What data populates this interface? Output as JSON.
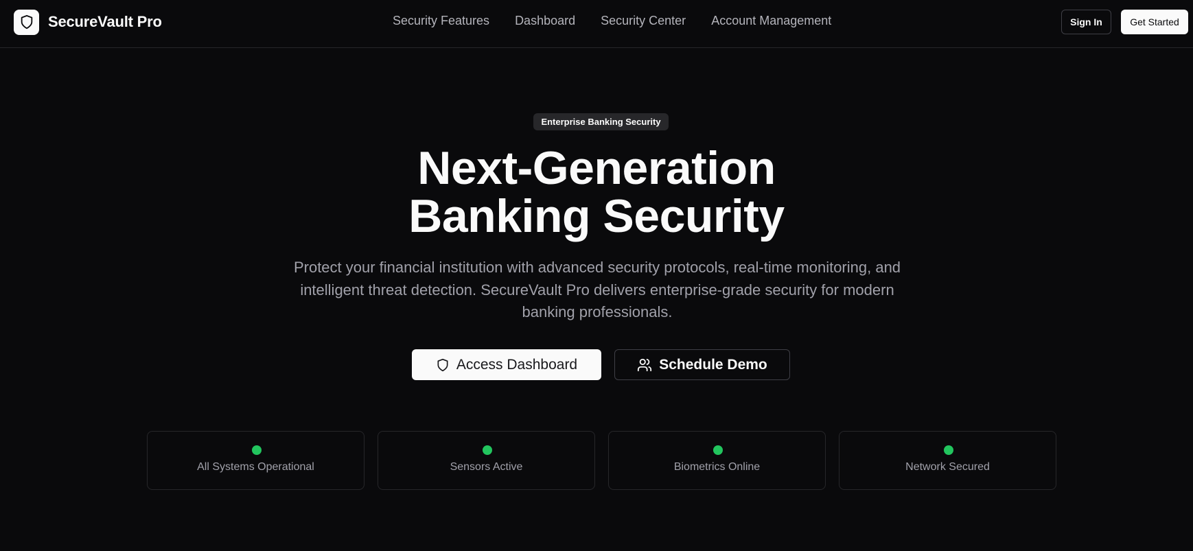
{
  "brand": {
    "name": "SecureVault Pro",
    "logo_icon": "shield-icon"
  },
  "nav": {
    "items": [
      {
        "label": "Security Features"
      },
      {
        "label": "Dashboard"
      },
      {
        "label": "Security Center"
      },
      {
        "label": "Account Management"
      }
    ]
  },
  "header_actions": {
    "sign_in": "Sign In",
    "get_started": "Get Started"
  },
  "hero": {
    "badge": "Enterprise Banking Security",
    "headline_line1": "Next-Generation",
    "headline_line2": "Banking Security",
    "description": "Protect your financial institution with advanced security protocols, real-time monitoring, and intelligent threat detection. SecureVault Pro delivers enterprise-grade security for modern banking professionals.",
    "primary_cta": {
      "label": "Access Dashboard",
      "icon": "shield-icon"
    },
    "secondary_cta": {
      "label": "Schedule Demo",
      "icon": "users-icon"
    }
  },
  "status": {
    "items": [
      {
        "label": "All Systems Operational",
        "color": "#22c55e"
      },
      {
        "label": "Sensors Active",
        "color": "#22c55e"
      },
      {
        "label": "Biometrics Online",
        "color": "#22c55e"
      },
      {
        "label": "Network Secured",
        "color": "#22c55e"
      }
    ]
  },
  "colors": {
    "background": "#0a0a0c",
    "foreground": "#fafafa",
    "muted": "#a1a1aa",
    "border": "#27272a",
    "status_ok": "#22c55e"
  }
}
